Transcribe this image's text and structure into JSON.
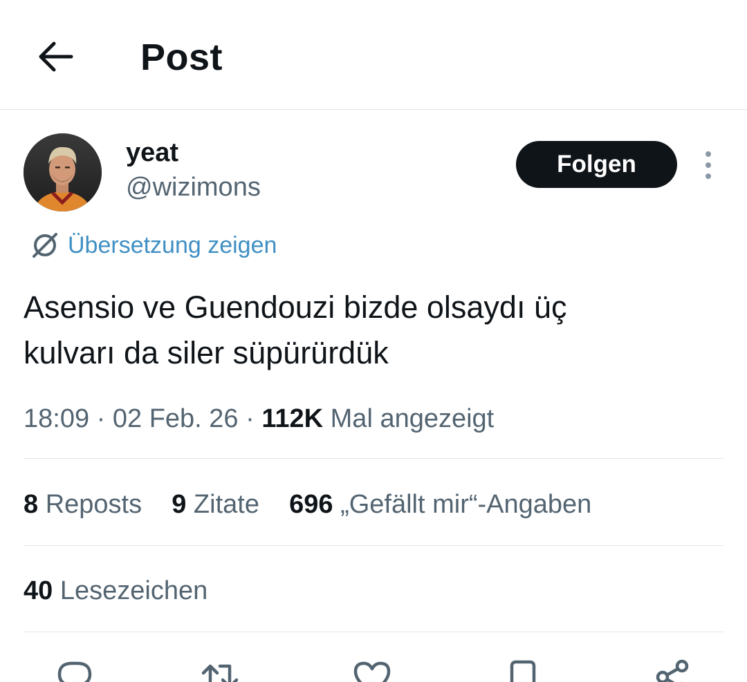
{
  "header": {
    "back_icon": "arrow-left-icon",
    "title": "Post"
  },
  "author": {
    "avatar_icon": "avatar",
    "display_name": "yeat",
    "handle": "@wizimons",
    "follow_label": "Folgen",
    "more_icon": "more-vertical-icon"
  },
  "translation": {
    "icon": "translate-icon",
    "label": "Übersetzung zeigen"
  },
  "tweet": {
    "text_line1": "Asensio ve Guendouzi bizde olsaydı üç",
    "text_line2": "kulvarı da siler süpürürdük",
    "time": "18:09",
    "sep1": " · ",
    "date": "02 Feb. 26",
    "sep2": " · ",
    "views": "112K",
    "views_label": " Mal angezeigt"
  },
  "stats": {
    "reposts_count": "8",
    "reposts_label": " Reposts",
    "quotes_count": "9",
    "quotes_label": " Zitate",
    "likes_count": "696",
    "likes_label": " „Gefällt mir“-Angaben",
    "bookmarks_count": "40",
    "bookmarks_label": " Lesezeichen"
  },
  "actions": [
    {
      "icon": "reply-icon"
    },
    {
      "icon": "repost-icon"
    },
    {
      "icon": "like-icon"
    },
    {
      "icon": "bookmark-icon"
    },
    {
      "icon": "share-icon"
    }
  ],
  "colors": {
    "text": "#0f1419",
    "secondary": "#536471",
    "link": "#3f8fc4",
    "divider": "#e1e4e8",
    "button": "#0f1419"
  }
}
